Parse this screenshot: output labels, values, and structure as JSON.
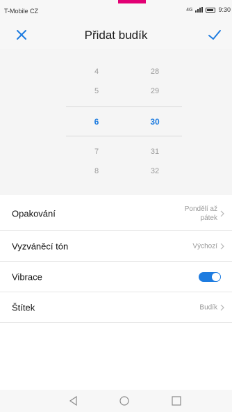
{
  "status_bar": {
    "carrier": "T-Mobile CZ",
    "network": "4G",
    "time": "9:30",
    "brand_color": "#e20074"
  },
  "header": {
    "title": "Přidat budík",
    "close_icon": "close-icon",
    "confirm_icon": "checkmark-icon",
    "accent": "#1e7ce0"
  },
  "time_picker": {
    "hours": [
      "4",
      "5",
      "6",
      "7",
      "8"
    ],
    "minutes": [
      "28",
      "29",
      "30",
      "31",
      "32"
    ],
    "selected_hour": "6",
    "selected_minute": "30"
  },
  "settings": {
    "repeat": {
      "label": "Opakování",
      "value_line1": "Pondělí až",
      "value_line2": "pátek"
    },
    "ringtone": {
      "label": "Vyzváněcí tón",
      "value": "Výchozí"
    },
    "vibration": {
      "label": "Vibrace",
      "enabled": true
    },
    "label": {
      "label": "Štítek",
      "value": "Budík"
    }
  },
  "nav_bar": {
    "back_icon": "back-triangle-icon",
    "home_icon": "home-circle-icon",
    "recents_icon": "recents-square-icon"
  }
}
